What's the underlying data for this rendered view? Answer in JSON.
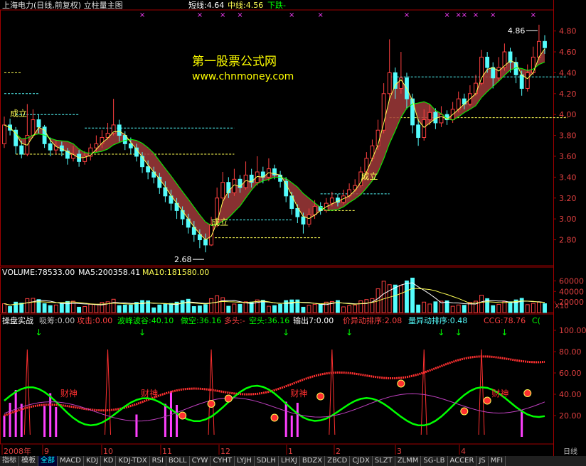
{
  "window": {
    "title": "上海电力(日线,前复权) 立柱量主图",
    "short_line": "短线:4.64",
    "mid_line": "中线:4.56",
    "trend": "下跌-"
  },
  "watermark": {
    "name": "第一股票公式网",
    "url": "www.chnmoney.com"
  },
  "main_chart": {
    "y_ticks": [
      "4.80",
      "4.60",
      "4.40",
      "4.20",
      "4.00",
      "3.80",
      "3.60",
      "3.40",
      "3.20",
      "3.00",
      "2.80"
    ],
    "y_range": [
      2.68,
      4.86
    ],
    "high_label": "4.86",
    "low_label": "2.68",
    "signal_labels": [
      "成立",
      "成立",
      "成立"
    ],
    "candles": [
      [
        3.72,
        3.9,
        3.98,
        3.68
      ],
      [
        3.9,
        3.85,
        3.96,
        3.8
      ],
      [
        3.85,
        3.7,
        3.88,
        3.62
      ],
      [
        3.7,
        3.62,
        3.75,
        3.58
      ],
      [
        3.62,
        3.8,
        4.1,
        3.6
      ],
      [
        3.8,
        3.95,
        4.05,
        3.78
      ],
      [
        3.95,
        3.88,
        4.0,
        3.82
      ],
      [
        3.88,
        3.72,
        3.9,
        3.68
      ],
      [
        3.72,
        3.66,
        3.78,
        3.6
      ],
      [
        3.66,
        3.7,
        3.76,
        3.62
      ],
      [
        3.7,
        3.65,
        3.74,
        3.6
      ],
      [
        3.65,
        3.58,
        3.68,
        3.52
      ],
      [
        3.58,
        3.62,
        3.7,
        3.55
      ],
      [
        3.62,
        3.55,
        3.66,
        3.5
      ],
      [
        3.55,
        3.6,
        3.65,
        3.52
      ],
      [
        3.6,
        3.68,
        3.72,
        3.56
      ],
      [
        3.68,
        3.72,
        3.8,
        3.64
      ],
      [
        3.72,
        3.78,
        3.85,
        3.68
      ],
      [
        3.78,
        3.82,
        3.92,
        3.76
      ],
      [
        3.82,
        3.9,
        4.15,
        3.8
      ],
      [
        3.9,
        3.8,
        3.95,
        3.74
      ],
      [
        3.8,
        3.72,
        3.84,
        3.66
      ],
      [
        3.72,
        3.68,
        3.78,
        3.62
      ],
      [
        3.68,
        3.6,
        3.72,
        3.55
      ],
      [
        3.6,
        3.5,
        3.64,
        3.44
      ],
      [
        3.5,
        3.45,
        3.56,
        3.38
      ],
      [
        3.45,
        3.4,
        3.5,
        3.34
      ],
      [
        3.4,
        3.3,
        3.44,
        3.24
      ],
      [
        3.3,
        3.22,
        3.36,
        3.16
      ],
      [
        3.22,
        3.15,
        3.28,
        3.08
      ],
      [
        3.15,
        3.08,
        3.2,
        3.0
      ],
      [
        3.08,
        3.0,
        3.12,
        2.94
      ],
      [
        3.0,
        2.92,
        3.05,
        2.86
      ],
      [
        2.92,
        2.85,
        2.98,
        2.78
      ],
      [
        2.85,
        2.8,
        2.9,
        2.72
      ],
      [
        2.8,
        2.75,
        2.86,
        2.68
      ],
      [
        2.75,
        2.95,
        3.02,
        2.74
      ],
      [
        2.95,
        3.2,
        3.3,
        2.92
      ],
      [
        3.2,
        3.35,
        3.45,
        3.15
      ],
      [
        3.35,
        3.25,
        3.4,
        3.2
      ],
      [
        3.25,
        3.38,
        3.48,
        3.22
      ],
      [
        3.38,
        3.3,
        3.42,
        3.25
      ],
      [
        3.3,
        3.42,
        3.55,
        3.28
      ],
      [
        3.42,
        3.35,
        3.48,
        3.3
      ],
      [
        3.35,
        3.45,
        3.6,
        3.32
      ],
      [
        3.45,
        3.4,
        3.5,
        3.34
      ],
      [
        3.4,
        3.48,
        3.58,
        3.36
      ],
      [
        3.48,
        3.42,
        3.52,
        3.38
      ],
      [
        3.42,
        3.36,
        3.46,
        3.3
      ],
      [
        3.36,
        3.22,
        3.4,
        3.16
      ],
      [
        3.22,
        3.1,
        3.26,
        3.04
      ],
      [
        3.1,
        3.02,
        3.14,
        2.96
      ],
      [
        3.02,
        2.95,
        3.06,
        2.86
      ],
      [
        2.95,
        3.04,
        3.1,
        2.92
      ],
      [
        3.04,
        3.12,
        3.18,
        3.0
      ],
      [
        3.12,
        3.08,
        3.16,
        3.04
      ],
      [
        3.08,
        3.15,
        3.2,
        3.06
      ],
      [
        3.15,
        3.2,
        3.26,
        3.12
      ],
      [
        3.2,
        3.16,
        3.24,
        3.12
      ],
      [
        3.16,
        3.22,
        3.28,
        3.14
      ],
      [
        3.22,
        3.28,
        3.34,
        3.2
      ],
      [
        3.28,
        3.32,
        3.38,
        3.26
      ],
      [
        3.32,
        3.45,
        3.5,
        3.3
      ],
      [
        3.45,
        3.58,
        3.64,
        3.42
      ],
      [
        3.58,
        3.7,
        3.76,
        3.55
      ],
      [
        3.7,
        3.85,
        3.95,
        3.66
      ],
      [
        3.85,
        4.2,
        4.3,
        3.82
      ],
      [
        4.2,
        4.4,
        4.72,
        4.15
      ],
      [
        4.4,
        4.25,
        4.45,
        4.15
      ],
      [
        4.25,
        4.35,
        4.6,
        4.2
      ],
      [
        4.35,
        4.15,
        4.4,
        4.05
      ],
      [
        4.15,
        3.9,
        4.2,
        3.82
      ],
      [
        3.9,
        3.78,
        3.96,
        3.7
      ],
      [
        3.78,
        3.95,
        4.05,
        3.75
      ],
      [
        3.95,
        4.02,
        4.1,
        3.9
      ],
      [
        4.02,
        3.92,
        4.06,
        3.86
      ],
      [
        3.92,
        4.0,
        4.08,
        3.88
      ],
      [
        4.0,
        3.95,
        4.04,
        3.9
      ],
      [
        3.95,
        4.05,
        4.12,
        3.92
      ],
      [
        4.05,
        4.15,
        4.22,
        4.02
      ],
      [
        4.15,
        4.1,
        4.2,
        4.05
      ],
      [
        4.1,
        4.2,
        4.28,
        4.08
      ],
      [
        4.2,
        4.3,
        4.38,
        4.18
      ],
      [
        4.3,
        4.55,
        4.62,
        4.28
      ],
      [
        4.55,
        4.45,
        4.6,
        4.4
      ],
      [
        4.45,
        4.35,
        4.5,
        4.25
      ],
      [
        4.35,
        4.45,
        4.55,
        4.32
      ],
      [
        4.45,
        4.6,
        4.68,
        4.42
      ],
      [
        4.6,
        4.5,
        4.64,
        4.4
      ],
      [
        4.5,
        4.38,
        4.55,
        4.3
      ],
      [
        4.38,
        4.25,
        4.42,
        4.18
      ],
      [
        4.25,
        4.4,
        4.48,
        4.22
      ],
      [
        4.4,
        4.55,
        4.65,
        4.38
      ],
      [
        4.55,
        4.7,
        4.86,
        4.52
      ],
      [
        4.7,
        4.64,
        4.76,
        4.58
      ]
    ]
  },
  "volume_panel": {
    "header": "VOLUME:78533.00",
    "ma5": "MA5:200358.41",
    "ma10": "MA10:181580.00",
    "y_ticks": [
      "60000",
      "40000",
      "20000"
    ],
    "unit": "X10"
  },
  "indicator_panel": {
    "labels": [
      "操盘实战",
      "吸筹:0.00",
      "攻击:0.00",
      "波峰波谷:40.10",
      "做空:36.16",
      "多头:-",
      "空头:36.16",
      "输出7:0.00",
      "价异动排序:2.08",
      "量异动排序:0.48",
      "CCG:78.76",
      "C("
    ],
    "y_ticks": [
      "100.00",
      "80.00",
      "60.00",
      "40.00",
      "20.00"
    ],
    "text_marks": [
      "财神",
      "财神",
      "财神",
      "财神"
    ]
  },
  "x_axis": {
    "labels": [
      "2008年",
      "9",
      "10",
      "11",
      "12",
      "1",
      "2",
      "3",
      "4"
    ],
    "right_label": "日线"
  },
  "tabs": [
    "指标",
    "模板",
    "全部",
    "MACD",
    "KDJ",
    "KD",
    "KDJ-TDX",
    "RSI",
    "BOLL",
    "CYW",
    "CYHT",
    "LYJH",
    "SDLH",
    "LHXJ",
    "BDZX",
    "ZBCD",
    "CJDX",
    "SLZT",
    "ZLMM",
    "SG-LB",
    "ACCER",
    "JS",
    "MFI"
  ],
  "active_tab": "全部",
  "colors": {
    "up": "#ff4040",
    "down": "#54fcfc",
    "ma_short": "#ffff54",
    "ma_mid": "#00ff00",
    "band": "#a03a3a",
    "magenta": "#ff40ff",
    "green": "#00ff00"
  }
}
